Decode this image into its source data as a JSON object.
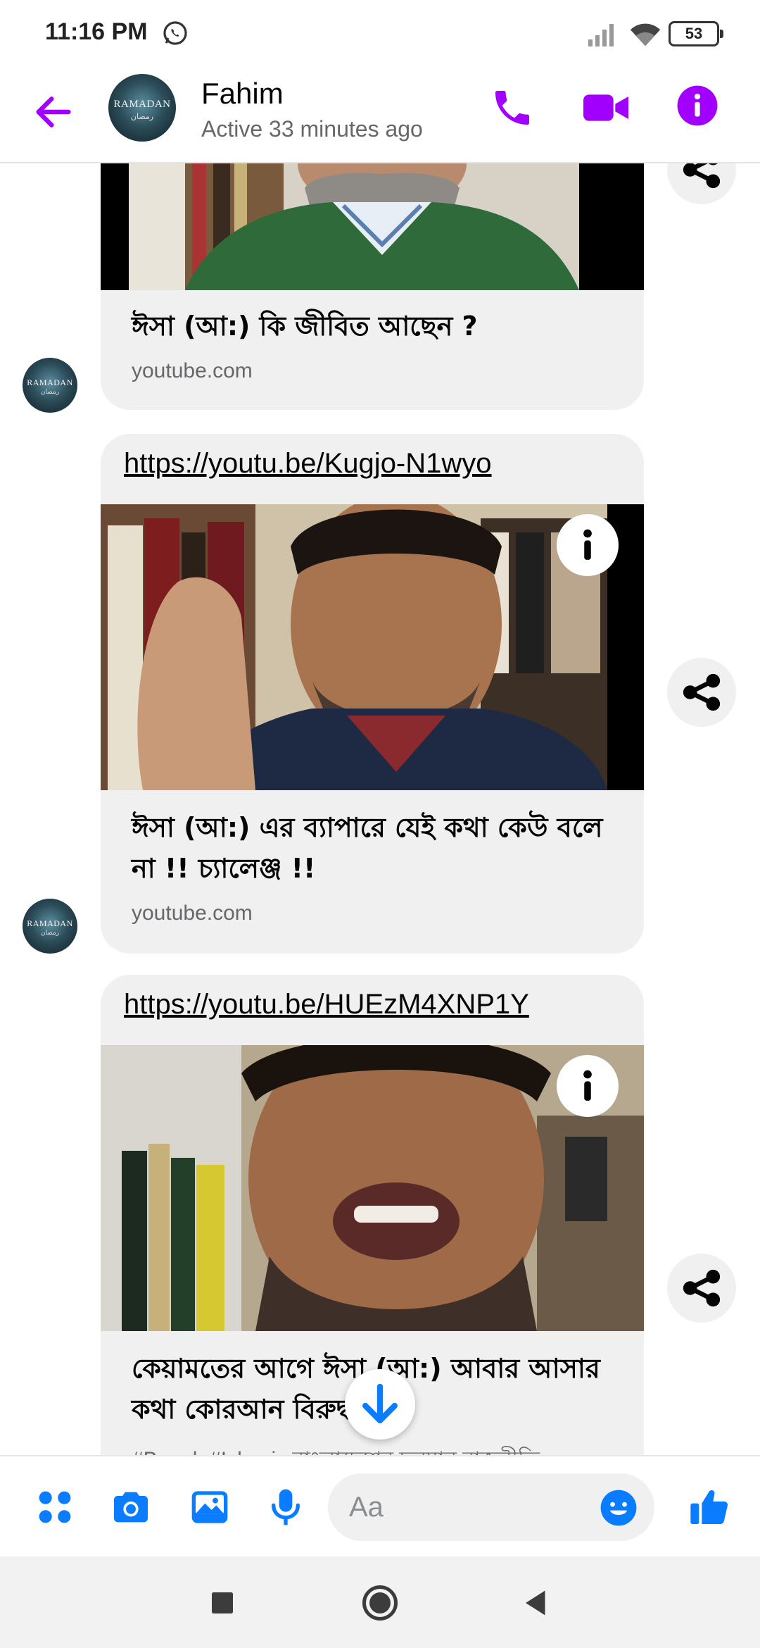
{
  "status_bar": {
    "time": "11:16 PM",
    "battery": "53",
    "icons": [
      "whatsapp-icon",
      "signal-icon",
      "wifi-icon",
      "battery-icon"
    ]
  },
  "header": {
    "contact_name": "Fahim",
    "active_status": "Active 33 minutes ago",
    "avatar_text": "RAMADAN",
    "avatar_subtext": "رمضان",
    "icons": [
      "back-arrow-icon",
      "phone-icon",
      "video-camera-icon",
      "info-icon"
    ],
    "accent_color": "#a100ff"
  },
  "messages": [
    {
      "title": "ঈসা (আ:) কি জীবিত আছেন ?",
      "domain": "youtube.com"
    },
    {
      "link": "https://youtu.be/Kugjo-N1wyo",
      "title": "ঈসা (আ:) এর ব্যাপারে যেই কথা কেউ বলে না !! চ্যালেঞ্জ !!",
      "domain": "youtube.com"
    },
    {
      "link": "https://youtu.be/HUEzM4XNP1Y",
      "title": "কেয়ামতের আগে ঈসা (আ:) আবার আসার কথা কোরআন বিরুদ্ধ !",
      "description": "#Bangla#Islamic বাংলাদেশের চলমান রাজনীতি"
    }
  ],
  "composer": {
    "placeholder": "Aa",
    "icons": [
      "apps-icon",
      "camera-icon",
      "gallery-icon",
      "microphone-icon",
      "emoji-icon",
      "thumbs-up-icon"
    ],
    "accent_color": "#0a7cff"
  },
  "nav_bar": {
    "icons": [
      "recents-square-icon",
      "home-circle-icon",
      "back-triangle-icon"
    ]
  }
}
